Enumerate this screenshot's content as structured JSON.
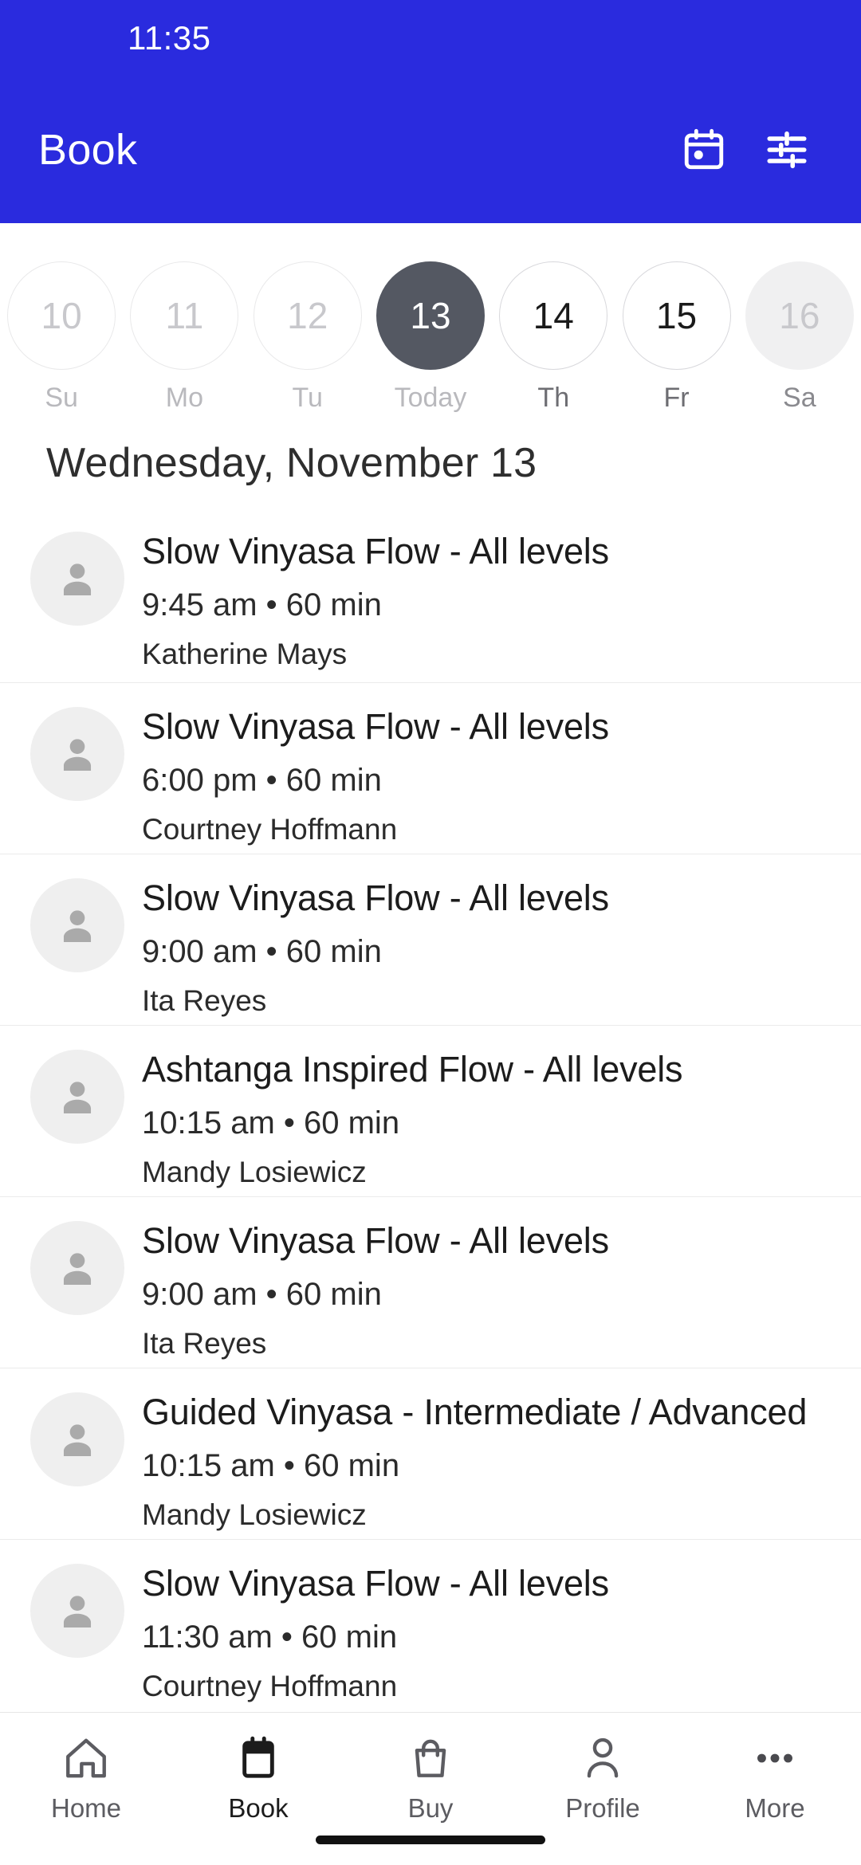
{
  "status_bar": {
    "time": "11:35"
  },
  "app_bar": {
    "title": "Book",
    "calendar_icon": "calendar-icon",
    "filter_icon": "filter-sliders-icon"
  },
  "theme": {
    "brand_blue": "#2A2BDE",
    "selected_date_bg": "#545862",
    "muted_text": "#b9b9bd",
    "body_text": "#1c1c1c"
  },
  "date_strip": {
    "dates": [
      {
        "number": "10",
        "day": "Su",
        "state": "disabled"
      },
      {
        "number": "11",
        "day": "Mo",
        "state": "disabled"
      },
      {
        "number": "12",
        "day": "Tu",
        "state": "disabled"
      },
      {
        "number": "13",
        "day": "Today",
        "state": "selected"
      },
      {
        "number": "14",
        "day": "Th",
        "state": "enabled"
      },
      {
        "number": "15",
        "day": "Fr",
        "state": "enabled"
      },
      {
        "number": "16",
        "day": "Sa",
        "state": "filled"
      }
    ]
  },
  "day_heading": "Wednesday, November 13",
  "classes": [
    {
      "title": "Slow Vinyasa Flow - All levels",
      "meta": "9:45 am • 60 min",
      "teacher": "Katherine Mays"
    },
    {
      "title": "Slow Vinyasa Flow - All levels",
      "meta": "6:00 pm • 60 min",
      "teacher": "Courtney Hoffmann"
    },
    {
      "title": "Slow Vinyasa Flow - All levels",
      "meta": "9:00 am • 60 min",
      "teacher": "Ita Reyes"
    },
    {
      "title": "Ashtanga Inspired Flow - All levels",
      "meta": "10:15 am • 60 min",
      "teacher": "Mandy Losiewicz"
    },
    {
      "title": "Slow Vinyasa Flow - All levels",
      "meta": "9:00 am • 60 min",
      "teacher": "Ita Reyes"
    },
    {
      "title": "Guided Vinyasa - Intermediate / Advanced",
      "meta": "10:15 am • 60 min",
      "teacher": "Mandy Losiewicz"
    },
    {
      "title": "Slow Vinyasa Flow - All levels",
      "meta": "11:30 am • 60 min",
      "teacher": "Courtney Hoffmann"
    }
  ],
  "bottom_nav": {
    "items": [
      {
        "label": "Home",
        "icon": "home-icon",
        "active": false
      },
      {
        "label": "Book",
        "icon": "calendar-icon",
        "active": true
      },
      {
        "label": "Buy",
        "icon": "shopping-bag-icon",
        "active": false
      },
      {
        "label": "Profile",
        "icon": "person-icon",
        "active": false
      },
      {
        "label": "More",
        "icon": "ellipsis-icon",
        "active": false
      }
    ]
  }
}
